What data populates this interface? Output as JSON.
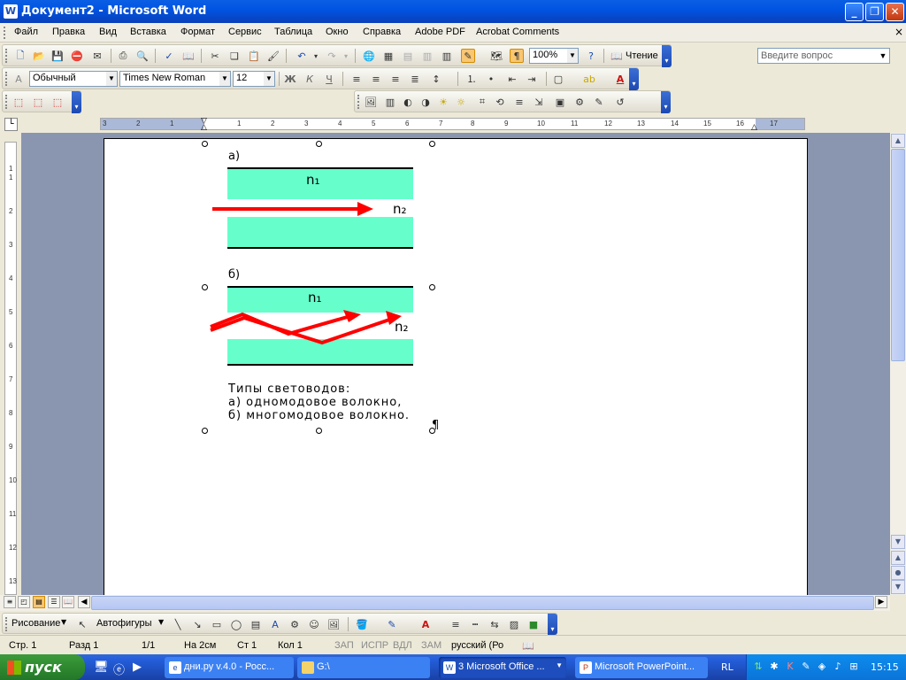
{
  "window": {
    "title": "Документ2 - Microsoft Word",
    "app_icon": "word-icon"
  },
  "menu": {
    "items": [
      "Файл",
      "Правка",
      "Вид",
      "Вставка",
      "Формат",
      "Сервис",
      "Таблица",
      "Окно",
      "Справка",
      "Adobe PDF",
      "Acrobat Comments"
    ],
    "help_placeholder": "Введите вопрос"
  },
  "standard_toolbar": {
    "zoom": "100%",
    "reading_label": "Чтение"
  },
  "format_toolbar": {
    "style": "Обычный",
    "font": "Times New Roman",
    "size": "12",
    "bold": "Ж",
    "italic": "К",
    "underline": "Ч"
  },
  "ruler": {
    "h_ticks": [
      "3",
      "2",
      "1",
      "1",
      "2",
      "3",
      "4",
      "5",
      "6",
      "7",
      "8",
      "9",
      "10",
      "11",
      "12",
      "13",
      "14",
      "15",
      "16",
      "17"
    ],
    "v_ticks": [
      "1",
      "1",
      "2",
      "3",
      "4",
      "5",
      "6",
      "7",
      "8",
      "9",
      "10",
      "11",
      "12",
      "13"
    ]
  },
  "figure": {
    "a_label": "а)",
    "b_label": "б)",
    "n1": "n₁",
    "n2": "n₂",
    "caption": [
      "Типы световодов:",
      "а) одномодовое волокно,",
      "б) многомодовое волокно."
    ],
    "pilcrow": "¶",
    "cladding_color": "#66ffcc",
    "arrow_color": "#ff0000"
  },
  "drawing_toolbar": {
    "draw_label": "Рисование",
    "autoshapes_label": "Автофигуры"
  },
  "status": {
    "page": "Стр. 1",
    "section": "Разд 1",
    "pages": "1/1",
    "at": "На 2см",
    "line": "Ст 1",
    "col": "Кол 1",
    "rec": "ЗАП",
    "trk": "ИСПР",
    "ext": "ВДЛ",
    "ovr": "ЗАМ",
    "lang": "русский (Ро"
  },
  "taskbar": {
    "start_label": "пуск",
    "tasks": [
      "дни.ру v.4.0 - Росс...",
      "G:\\",
      "3 Microsoft Office ...",
      "Microsoft PowerPoint..."
    ],
    "lang": "RL",
    "clock": "15:15"
  }
}
